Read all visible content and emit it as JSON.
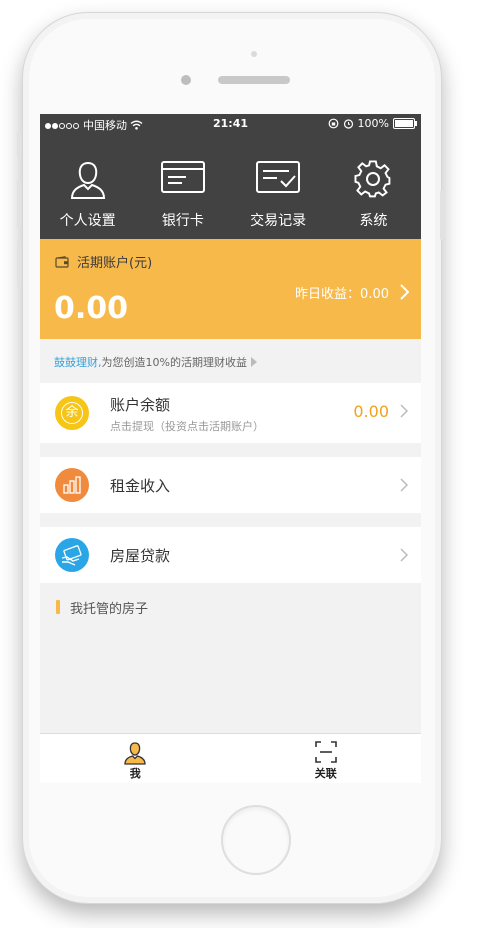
{
  "status_bar": {
    "carrier": "中国移动",
    "time": "21:41",
    "battery": "100%"
  },
  "top_nav": {
    "items": [
      {
        "label": "个人设置",
        "icon": "person-icon"
      },
      {
        "label": "银行卡",
        "icon": "bank-card-icon"
      },
      {
        "label": "交易记录",
        "icon": "transaction-record-icon"
      },
      {
        "label": "系统",
        "icon": "gear-icon"
      }
    ]
  },
  "account_card": {
    "title": "活期账户(元)",
    "amount": "0.00",
    "yesterday_label": "昨日收益：0.00",
    "background": "#f7b94a"
  },
  "promo": {
    "brand": "鼓鼓理财,",
    "text": "为您创造10%的活期理财收益"
  },
  "rows": {
    "balance": {
      "title": "账户余额",
      "subtitle": "点击提现（投资点击活期账户）",
      "value": "0.00",
      "icon_text": "余",
      "icon_color": "#f6c515"
    },
    "rent": {
      "title": "租金收入",
      "icon_color": "#f08a3c"
    },
    "loan": {
      "title": "房屋贷款",
      "icon_color": "#2aa6e6"
    }
  },
  "section": {
    "title": "我托管的房子"
  },
  "tab_bar": {
    "tabs": [
      {
        "label": "我",
        "icon": "user-icon"
      },
      {
        "label": "关联",
        "icon": "scan-icon"
      }
    ]
  }
}
